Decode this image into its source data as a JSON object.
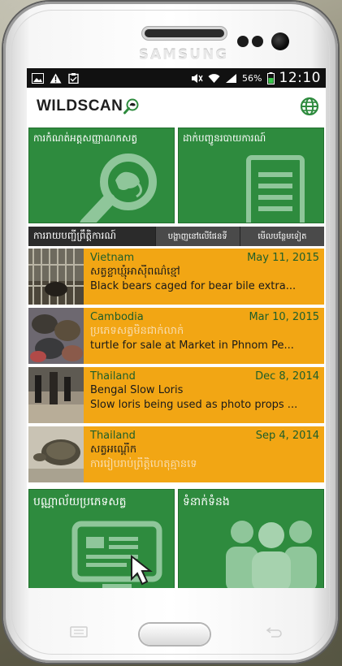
{
  "device": {
    "brand": "SAMSUNG"
  },
  "status_bar": {
    "left_icons": [
      "image-icon",
      "warning-icon",
      "clipboard-icon"
    ],
    "right_icons": [
      "mute-icon",
      "wifi-icon",
      "signal-icon",
      "battery-icon"
    ],
    "battery": "56%",
    "time": "12:10"
  },
  "app_bar": {
    "logo_text": "WILDSCAN",
    "colors": {
      "brand_green": "#2e8b3e",
      "accent_orange": "#f2a614"
    }
  },
  "tiles": {
    "identify_label": "ការកំណត់អត្តសញ្ញាណកសត្វ",
    "report_label": "ដាក់បញ្ជូនរបាយការណ៍"
  },
  "tabs": {
    "main_label": "ការរាយបញ្ជីព្រឹត្តិការណ៍",
    "map_label": "បង្ហាញនៅលើផែនទី",
    "more_label": "មើលបន្ថែមទៀត"
  },
  "incidents": [
    {
      "country": "Vietnam",
      "date": "May 11, 2015",
      "khmer": "សត្វខ្លាឃ្មុំអាស៊ីពណ៌ខ្មៅ",
      "description": "Black bears caged for bear bile extra..."
    },
    {
      "country": "Cambodia",
      "date": "Mar 10, 2015",
      "khmer": "ប្រភេទសត្វមិនជាក់លាក់",
      "description": "turtle for sale at Market in Phnom Pe..."
    },
    {
      "country": "Thailand",
      "date": "Dec 8, 2014",
      "khmer": "Bengal Slow Loris",
      "description": "Slow loris being used as photo props ..."
    },
    {
      "country": "Thailand",
      "date": "Sep 4, 2014",
      "khmer": "សត្វអណ្តើក",
      "description": "ការរៀបរាប់ព្រឹត្តិហេតុគ្មានទេ"
    }
  ],
  "bottom_tiles": {
    "library_label": "បណ្ណាល័យប្រភេទសត្វ",
    "contact_label": "ទំនាក់ទំនង"
  }
}
